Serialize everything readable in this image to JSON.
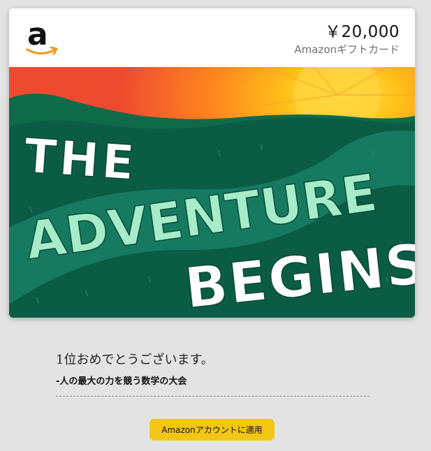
{
  "card": {
    "amount": "￥20,000",
    "type_label": "Amazonギフトカード",
    "logo": "amazon-logo",
    "art": {
      "headline_lines": [
        "THE",
        "ADVENTURE",
        "BEGINS"
      ],
      "colors": {
        "sky": "#ee4a30",
        "sun": "#ffc21a",
        "hills": "#0b5c45",
        "path": "#157a60",
        "text": "#ffffff",
        "accent_text": "#a6ecc9"
      }
    }
  },
  "message": {
    "text": "1位おめでとうございます。",
    "sender": "-人の最大の力を競う数学の大会"
  },
  "actions": {
    "apply_label": "Amazonアカウントに適用"
  },
  "colors": {
    "page_background": "#e3e3e3",
    "button": "#f3c614"
  }
}
